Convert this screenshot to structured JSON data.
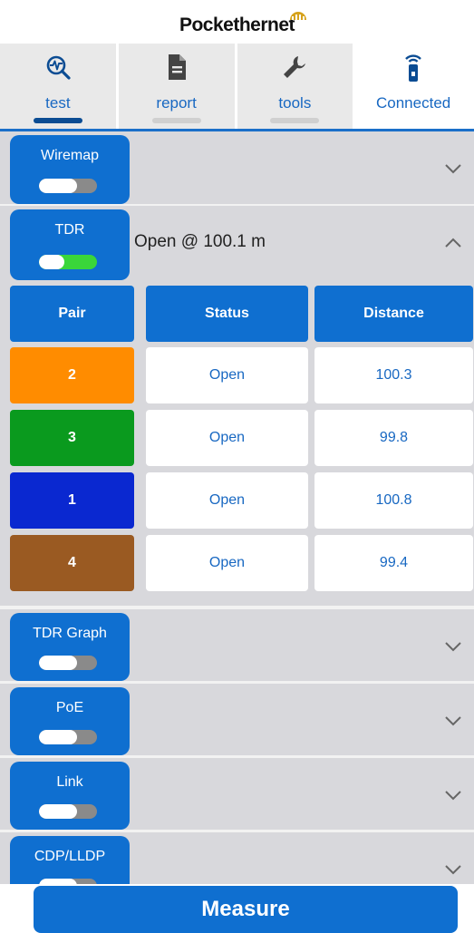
{
  "app": {
    "logo": "Pockethernet"
  },
  "tabs": [
    {
      "label": "test",
      "icon": "pulse-search-icon",
      "selected": true
    },
    {
      "label": "report",
      "icon": "document-icon",
      "selected": false
    },
    {
      "label": "tools",
      "icon": "wrench-icon",
      "selected": false
    },
    {
      "label": "Connected",
      "icon": "device-wireless-icon",
      "selected": false
    }
  ],
  "sections": {
    "wiremap": {
      "label": "Wiremap",
      "enabled": false,
      "expanded": false
    },
    "tdr": {
      "label": "TDR",
      "enabled": true,
      "expanded": true,
      "summary": "Open @ 100.1 m"
    },
    "tdr_graph": {
      "label": "TDR Graph",
      "enabled": false,
      "expanded": false
    },
    "poe": {
      "label": "PoE",
      "enabled": false,
      "expanded": false
    },
    "link": {
      "label": "Link",
      "enabled": false,
      "expanded": false
    },
    "cdp_lldp": {
      "label": "CDP/LLDP",
      "enabled": false,
      "expanded": false
    }
  },
  "tdr_table": {
    "headers": {
      "pair": "Pair",
      "status": "Status",
      "distance": "Distance"
    },
    "rows": [
      {
        "pair": "2",
        "status": "Open",
        "distance": "100.3",
        "color": "#ff8c00"
      },
      {
        "pair": "3",
        "status": "Open",
        "distance": "99.8",
        "color": "#0a9a1e"
      },
      {
        "pair": "1",
        "status": "Open",
        "distance": "100.8",
        "color": "#0a28d0"
      },
      {
        "pair": "4",
        "status": "Open",
        "distance": "99.4",
        "color": "#9a5a22"
      }
    ]
  },
  "actions": {
    "measure": "Measure"
  },
  "colors": {
    "accent": "#0f6fd0",
    "tab_text": "#1868c2"
  }
}
